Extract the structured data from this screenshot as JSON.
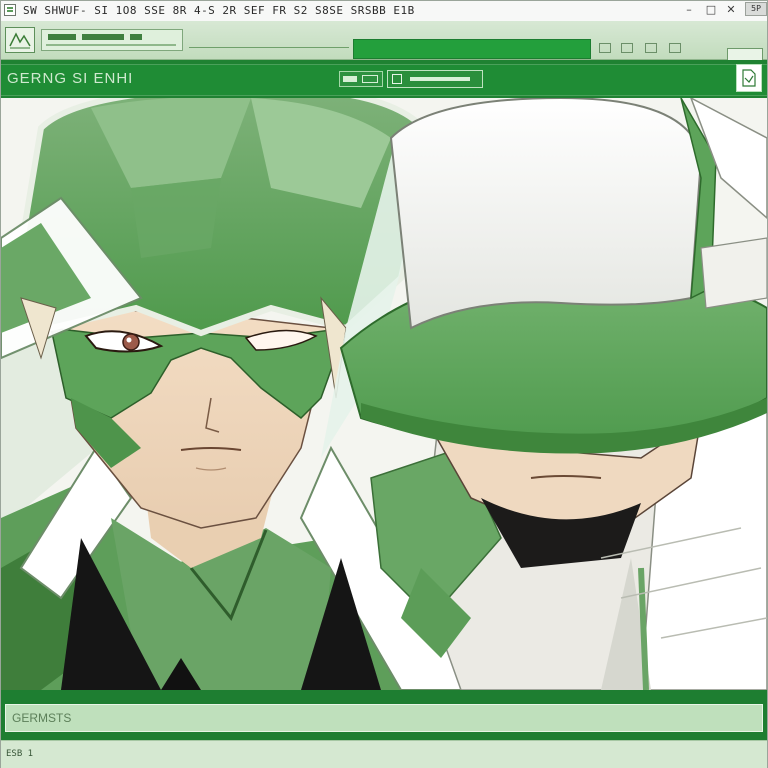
{
  "window": {
    "title": "SW SHWUF-  SI 1O8  SSE  8R 4-S  2R SEF  FR S2  S8SE  SRSBB E1B",
    "controls": {
      "minimize": "–",
      "maximize": "□",
      "close": "✕"
    },
    "extra_button": "5P"
  },
  "header": {
    "app_name": "GERNG SI ENHI"
  },
  "bottom": {
    "field_value": "GERMSTS"
  },
  "status": {
    "text": "ESB 1"
  },
  "colors": {
    "brand_green": "#1f8232",
    "active_tab": "#239f3c",
    "panel_green": "#c2dcbd"
  },
  "icons": [
    "app-icon",
    "logo-icon",
    "document-icon",
    "search-icon"
  ]
}
